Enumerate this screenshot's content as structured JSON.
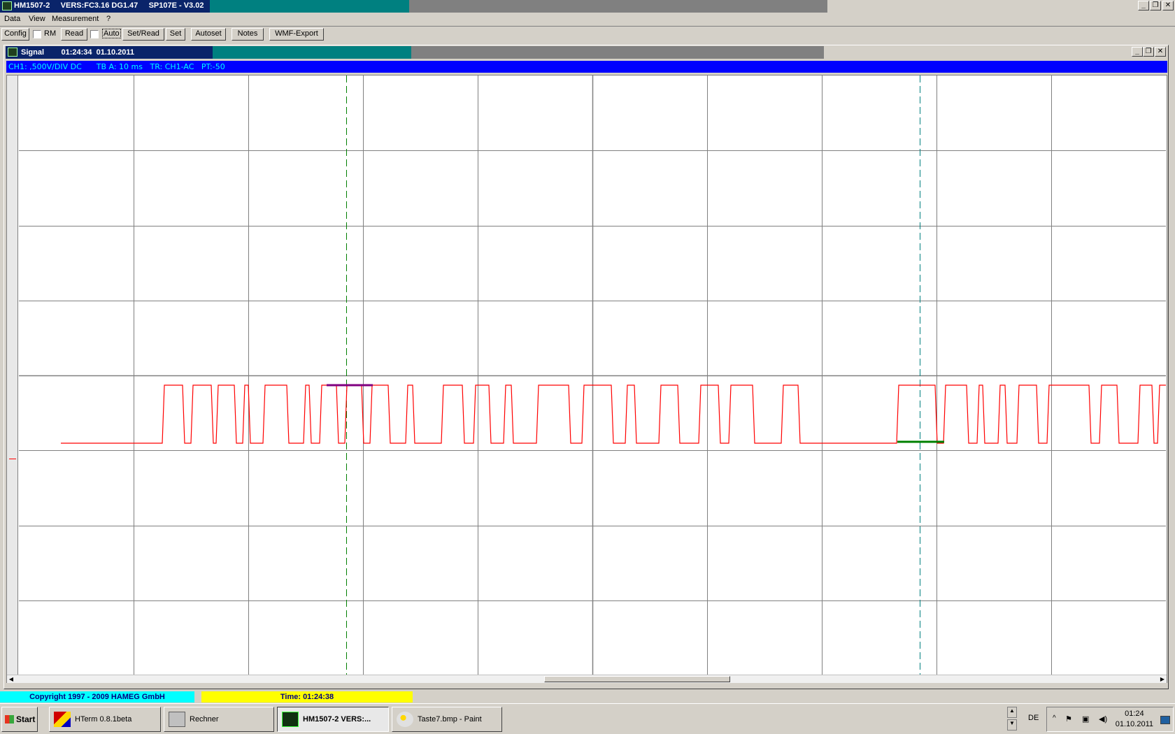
{
  "window": {
    "title": "HM1507-2     VERS:FC3.16 DG1.47     SP107E - V3.02",
    "controls": {
      "minimize": "_",
      "maximize": "❐",
      "close": "✕"
    }
  },
  "menu": [
    "Data",
    "View",
    "Measurement",
    "?"
  ],
  "toolbar": {
    "config": "Config",
    "rm_label": "RM",
    "read": "Read",
    "auto_label": "Auto",
    "set_read": "Set/Read",
    "set": "Set",
    "autoset": "Autoset",
    "notes": "Notes",
    "wmf_export": "WMF-Export"
  },
  "signal_window": {
    "title": "Signal        01:24:34  01.10.2011",
    "info": "CH1: ,500V/DIV DC      TB A: 10 ms   TR: CH1-AC   PT:-50",
    "trace_color": "#ff0000",
    "grid_color": "#808080",
    "cursor1_color": "#008000",
    "cursor2_color": "#008080",
    "marker1_color": "#800080",
    "marker2_color": "#008000"
  },
  "status": {
    "copyright": "Copyright 1997 - 2009 HAMEG GmbH",
    "time": "Time: 01:24:38"
  },
  "taskbar": {
    "start": "Start",
    "tasks": [
      {
        "label": "HTerm 0.8.1beta",
        "icon": "hterm-icon"
      },
      {
        "label": "Rechner",
        "icon": "calculator-icon"
      },
      {
        "label": "HM1507-2     VERS:...",
        "icon": "oscilloscope-icon",
        "active": true
      },
      {
        "label": "Taste7.bmp - Paint",
        "icon": "paint-icon"
      }
    ],
    "language": "DE",
    "clock_time": "01:24",
    "clock_date": "01.10.2011"
  }
}
